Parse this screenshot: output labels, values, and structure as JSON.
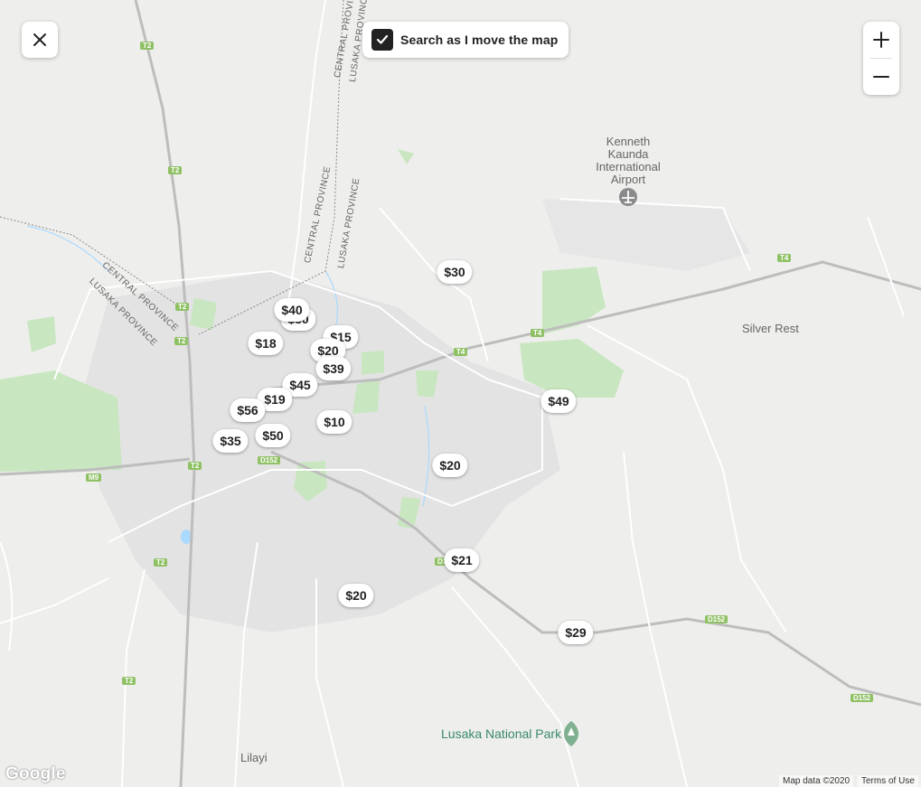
{
  "controls": {
    "search_label": "Search as I move the map"
  },
  "map_labels": {
    "airport": [
      "Kenneth",
      "Kaunda",
      "International",
      "Airport"
    ],
    "silver_rest": "Silver Rest",
    "lusaka_np": "Lusaka National Park",
    "lilayi": "Lilayi",
    "central_province": "CENTRAL PROVINCE",
    "lusaka_province": "LUSAKA PROVINCE"
  },
  "road_shields": [
    "T2",
    "T2",
    "T2",
    "T2",
    "T2",
    "T2",
    "T4",
    "T4",
    "T4",
    "M9",
    "D152",
    "D152",
    "D152",
    "D1"
  ],
  "price_pins": [
    "$40",
    "$30",
    "$18",
    "$15",
    "$20",
    "$39",
    "$45",
    "$19",
    "$56",
    "$10",
    "$50",
    "$35",
    "$30",
    "$49",
    "$20",
    "$21",
    "$20",
    "$29"
  ],
  "attribution": {
    "logo": "Google",
    "map_data": "Map data ©2020",
    "terms": "Terms of Use"
  },
  "colors": {
    "land": "#eeeeec",
    "urban": "#e3e3e3",
    "park": "#c8e6c0",
    "road": "#ffffff",
    "highway": "#bdbdbd",
    "shield": "#8fc164",
    "checkbox": "#222222"
  }
}
